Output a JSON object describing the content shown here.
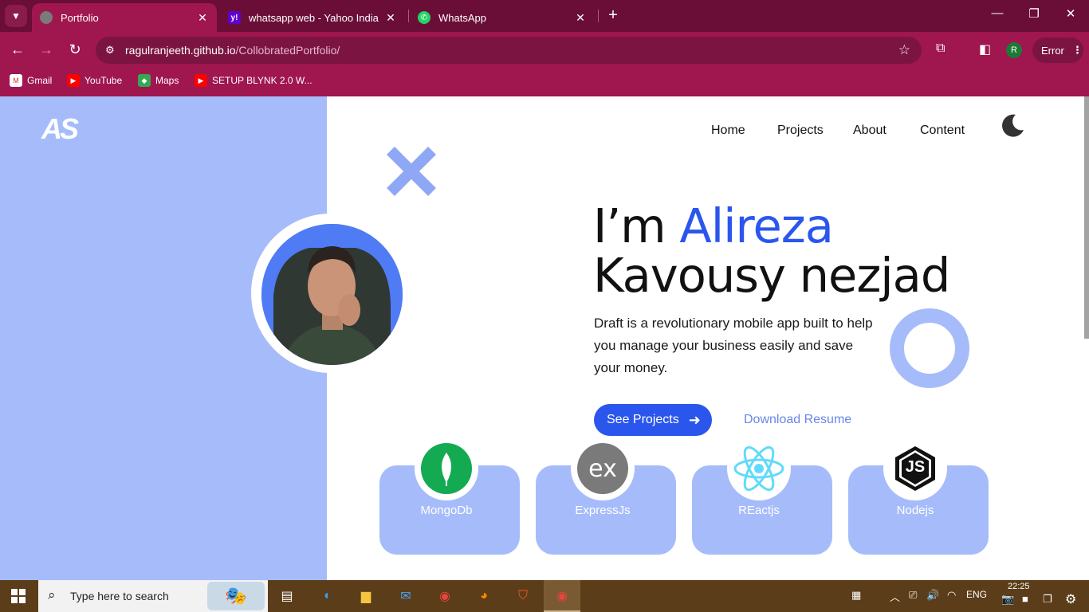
{
  "browser": {
    "tabs": [
      {
        "title": "Portfolio",
        "active": true
      },
      {
        "title": "whatsapp web - Yahoo India Se",
        "active": false
      },
      {
        "title": "WhatsApp",
        "active": false
      }
    ],
    "address": {
      "host": "ragulranjeeth.github.io",
      "path": "/CollobratedPortfolio/"
    },
    "profile_initial": "R",
    "error_label": "Error",
    "bookmarks": [
      "Gmail",
      "YouTube",
      "Maps",
      "SETUP BLYNK 2.0 W..."
    ]
  },
  "site": {
    "logo": "AS",
    "nav": [
      "Home",
      "Projects",
      "About",
      "Content"
    ],
    "hero": {
      "prefix": "I’m ",
      "first_name": "Alireza",
      "last_line": "Kavousy nezjad",
      "description": "Draft is a revolutionary mobile app built to help you manage your business easily and save your money."
    },
    "buttons": {
      "primary": "See Projects",
      "secondary": "Download Resume"
    },
    "skills": [
      {
        "label": "MongoDb",
        "icon": "mongodb-icon"
      },
      {
        "label": "ExpressJs",
        "icon": "express-icon",
        "icon_text": "ex"
      },
      {
        "label": "REactjs",
        "icon": "react-icon"
      },
      {
        "label": "Nodejs",
        "icon": "nodejs-icon",
        "icon_text": "JS"
      }
    ],
    "colors": {
      "accent": "#2b56ed",
      "panel": "#a6bcfa"
    }
  },
  "taskbar": {
    "search_placeholder": "Type here to search",
    "language": "ENG",
    "time": "22:25"
  }
}
